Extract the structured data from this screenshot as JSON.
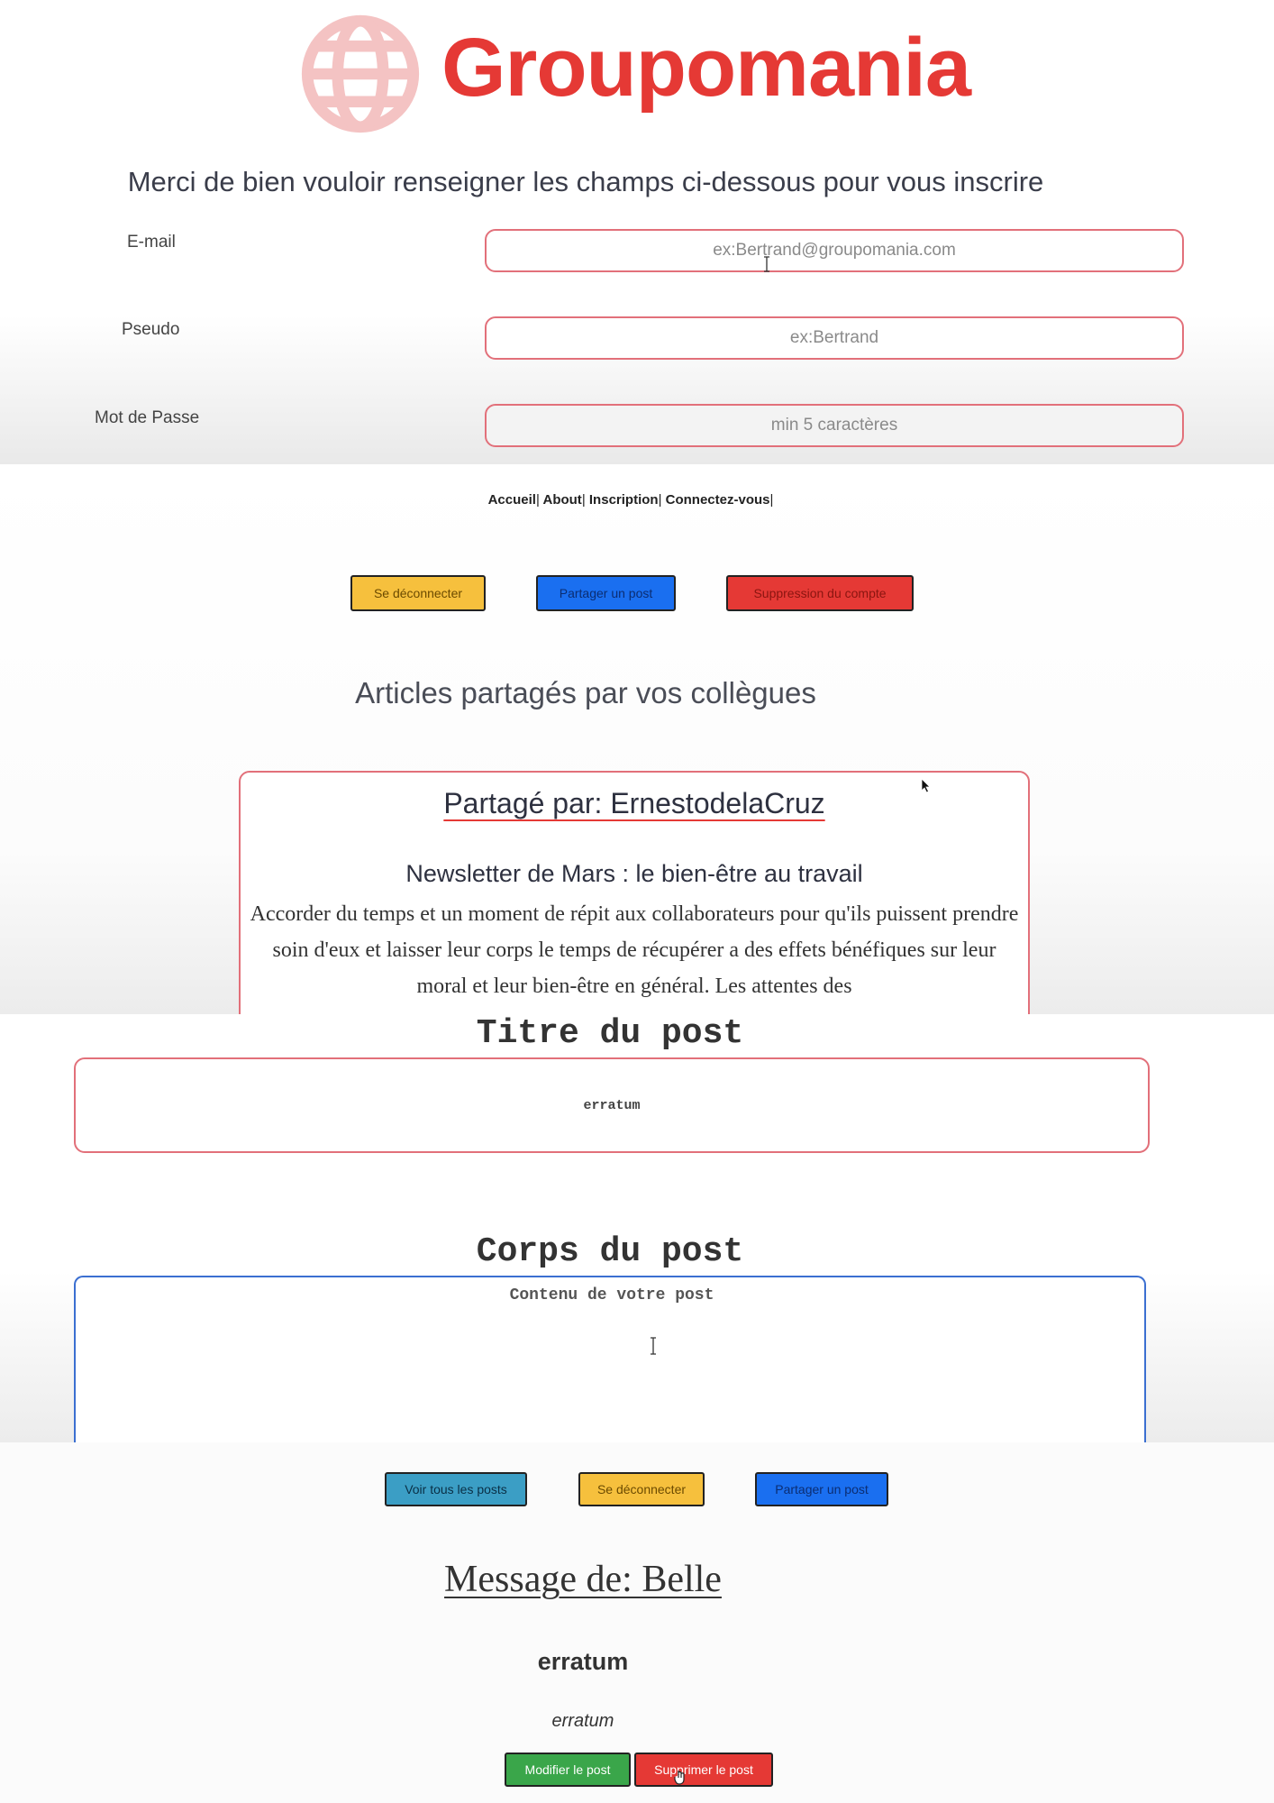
{
  "signup": {
    "brand": "Groupomania",
    "intro": "Merci de bien vouloir renseigner les champs ci-dessous pour vous inscrire",
    "fields": [
      {
        "label": "E-mail",
        "placeholder": "ex:Bertrand@groupomania.com"
      },
      {
        "label": "Pseudo",
        "placeholder": "ex:Bertrand"
      },
      {
        "label": "Mot de Passe",
        "placeholder": "min 5 caractères"
      }
    ]
  },
  "nav": {
    "links": [
      "Accueil",
      "About",
      "Inscription",
      "Connectez-vous"
    ],
    "separator": "|"
  },
  "home": {
    "buttons": {
      "logout": "Se déconnecter",
      "share": "Partager un post",
      "delete_account": "Suppression du compte"
    },
    "section_title": "Articles partagés par vos collègues",
    "article": {
      "author": "Partagé par: ErnestodelaCruz",
      "title": "Newsletter de Mars : le bien-être au travail",
      "body": "Accorder du temps et un moment de répit aux collaborateurs pour qu'ils puissent prendre soin d'eux et laisser leur corps le temps de récupérer a des effets bénéfiques sur leur moral et leur bien-être en général. Les attentes des"
    }
  },
  "post_form": {
    "title_label": "Titre du post",
    "title_value": "erratum",
    "body_label": "Corps du post",
    "body_placeholder": "Contenu de votre post"
  },
  "message_page": {
    "buttons": {
      "all_posts": "Voir tous les posts",
      "logout": "Se déconnecter",
      "share": "Partager un post"
    },
    "author": "Message de: Belle",
    "title": "erratum",
    "body": "erratum",
    "edit_button": "Modifier le post",
    "delete_button": "Supprimer le post"
  },
  "colors": {
    "brand_red": "#e53935",
    "input_border": "#e2707a",
    "yellow": "#f6c03d",
    "blue": "#1a6ff0",
    "green": "#3aa64a",
    "cyan": "#3b9ec5"
  },
  "icons": {
    "logo": "globe-icon",
    "cursor": "text-cursor-icon",
    "pointer": "mouse-pointer-icon"
  }
}
